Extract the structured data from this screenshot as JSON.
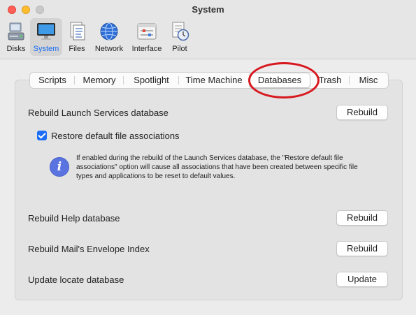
{
  "window": {
    "title": "System"
  },
  "toolbar": {
    "items": [
      {
        "label": "Disks",
        "icon": "disks-icon"
      },
      {
        "label": "System",
        "icon": "monitor-icon",
        "selected": true
      },
      {
        "label": "Files",
        "icon": "files-icon"
      },
      {
        "label": "Network",
        "icon": "globe-icon"
      },
      {
        "label": "Interface",
        "icon": "interface-icon"
      },
      {
        "label": "Pilot",
        "icon": "pilot-icon"
      }
    ]
  },
  "tabs": [
    {
      "label": "Scripts"
    },
    {
      "label": "Memory"
    },
    {
      "label": "Spotlight"
    },
    {
      "label": "Time Machine"
    },
    {
      "label": "Databases",
      "active": true
    },
    {
      "label": "Trash"
    },
    {
      "label": "Misc"
    }
  ],
  "databases": {
    "launch_services": {
      "label": "Rebuild Launch Services database",
      "button": "Rebuild"
    },
    "restore_checkbox": {
      "label": "Restore default file associations",
      "checked": true
    },
    "info_text": "If enabled during the rebuild of the Launch Services database, the \"Restore default file associations\" option will cause all associations that have been created between specific file types and applications to be reset to default values.",
    "help": {
      "label": "Rebuild Help database",
      "button": "Rebuild"
    },
    "mail": {
      "label": "Rebuild Mail's Envelope Index",
      "button": "Rebuild"
    },
    "locate": {
      "label": "Update locate database",
      "button": "Update"
    }
  },
  "colors": {
    "accent": "#1b6ef5",
    "annotation": "#d7191f",
    "info": "#5b73e0"
  }
}
